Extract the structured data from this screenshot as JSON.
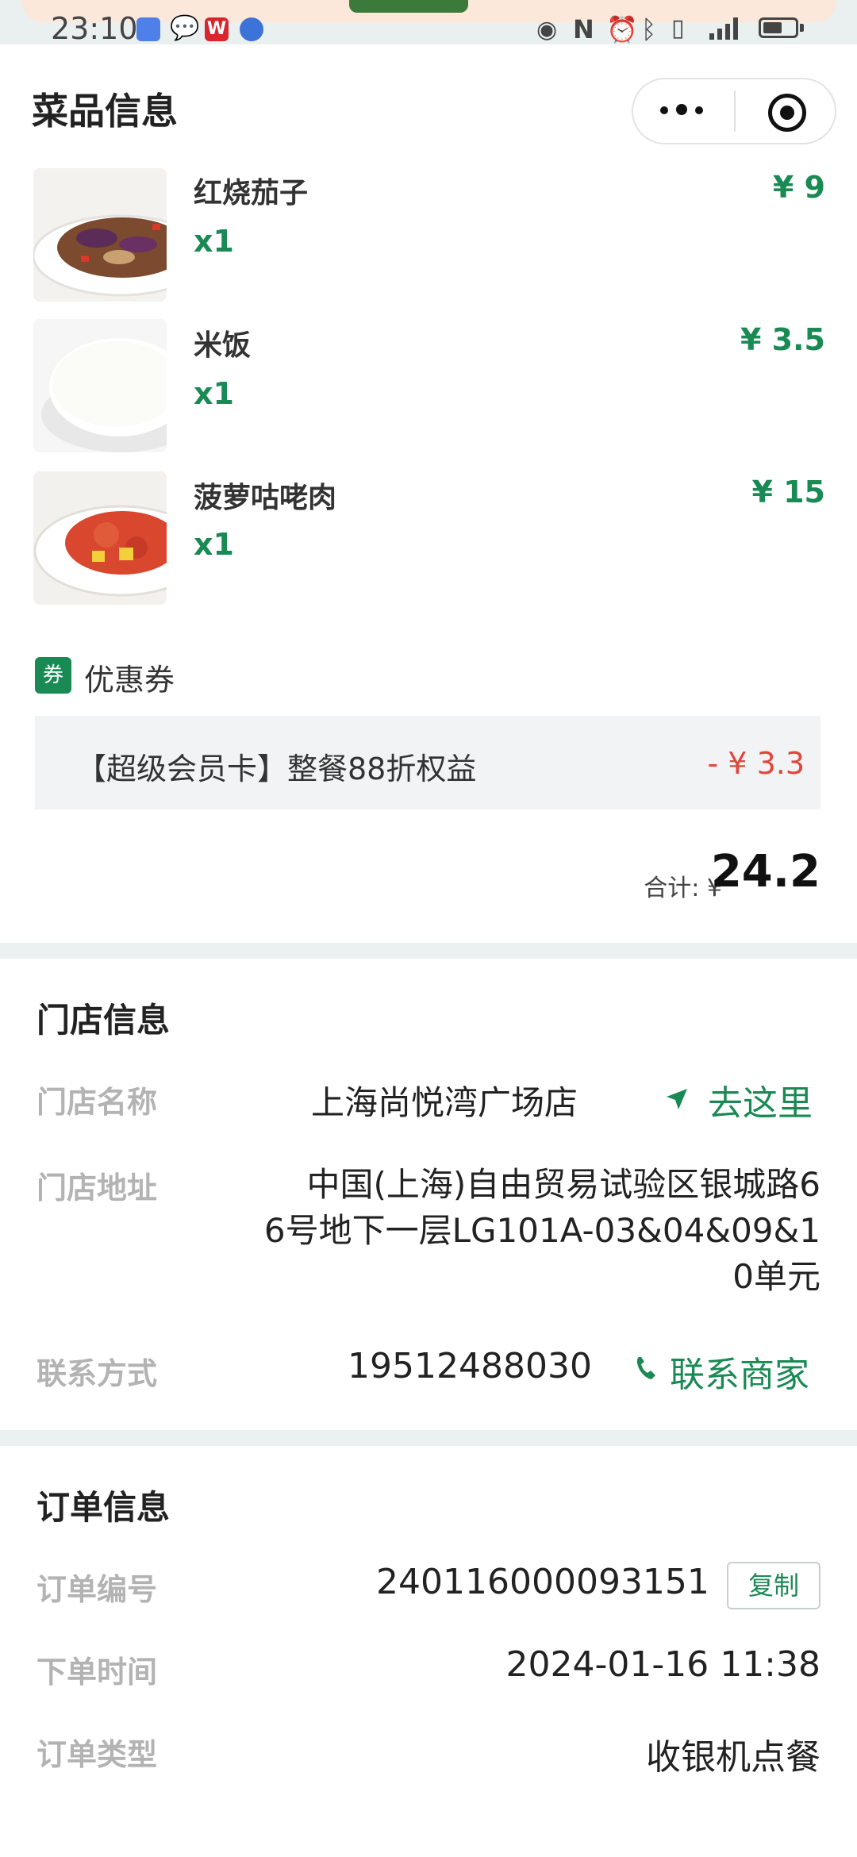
{
  "status_bar": {
    "time": "23:10",
    "battery_level": 0.6
  },
  "header": {
    "title": "菜品信息"
  },
  "dishes": [
    {
      "name": "红烧茄子",
      "qty": "x1",
      "price": "¥ 9"
    },
    {
      "name": "米饭",
      "qty": "x1",
      "price": "¥ 3.5"
    },
    {
      "name": "菠萝咕咾肉",
      "qty": "x1",
      "price": "¥ 15"
    }
  ],
  "coupon": {
    "tag": "券",
    "label": "优惠券",
    "text": "【超级会员卡】整餐88折权益",
    "amount": "- ¥ 3.3"
  },
  "total": {
    "label": "合计: ¥",
    "value": "24.2"
  },
  "store": {
    "title": "门店信息",
    "name_label": "门店名称",
    "name": "上海尚悦湾广场店",
    "go_label": "去这里",
    "address_label": "门店地址",
    "address_lines": [
      "中国(上海)自由贸易试验区银城路6",
      "6号地下一层LG101A-03&04&09&1",
      "0单元"
    ],
    "contact_label": "联系方式",
    "phone": "19512488030",
    "contact_button": "联系商家"
  },
  "order": {
    "title": "订单信息",
    "number_label": "订单编号",
    "number": "240116000093151",
    "copy_label": "复制",
    "time_label": "下单时间",
    "time": "2024-01-16 11:38",
    "type_label": "订单类型",
    "type": "收银机点餐"
  },
  "colors": {
    "accent": "#1a8a54",
    "discount": "#e0463b",
    "label_gray": "#b3b3b3"
  },
  "icons": [
    "wechat-icon",
    "wps-icon",
    "eye-icon",
    "nfc-icon",
    "alarm-icon",
    "bluetooth-icon",
    "signal-icon",
    "battery-icon",
    "more-dots-icon",
    "close-target-icon",
    "navigate-arrow-icon",
    "phone-icon"
  ]
}
